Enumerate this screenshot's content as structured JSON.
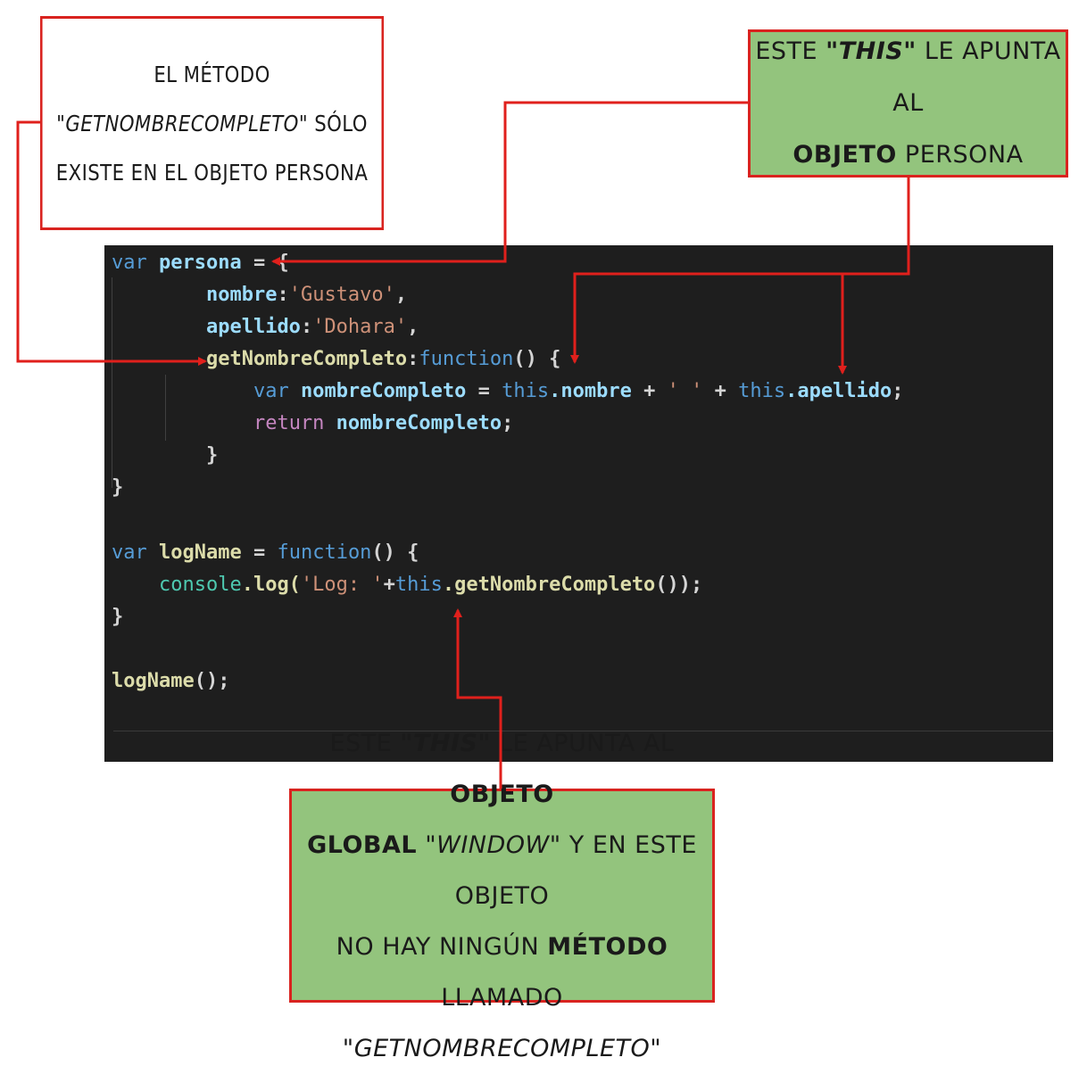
{
  "notes": {
    "method": {
      "line1": "El método",
      "line2_name": "\"getNombreCompleto\"",
      "line2_rest": " sólo",
      "line3": "existe en el objeto persona"
    },
    "this_persona": {
      "w1": "Este",
      "q": "\"this\"",
      "w2": " le apunta al",
      "bold": "objeto",
      "w3": " persona"
    },
    "this_window": {
      "w1": "Este",
      "q": "\"this\"",
      "w2": " le apunta al ",
      "bold1": "objeto",
      "bold2": "global",
      "q2": " \"window\"",
      "w3": " y en este objeto",
      "w4": "no hay ningún ",
      "bold3": "método",
      "w5": " llamado",
      "q3": "\"getNombreCompleto\""
    }
  },
  "code": {
    "l1": {
      "kw": "var",
      "id": "persona",
      "rest": " = {"
    },
    "l2": {
      "key": "nombre",
      "colon": ":",
      "str": "'Gustavo'",
      "end": ","
    },
    "l3": {
      "key": "apellido",
      "colon": ":",
      "str": "'Dohara'",
      "end": ","
    },
    "l4": {
      "key": "getNombreCompleto",
      "colon": ":",
      "kw": "function",
      "end": "() {"
    },
    "l5": {
      "kw": "var",
      "id": "nombreCompleto",
      "eq": " = ",
      "this1": "this",
      "p1": ".nombre",
      "plus1": " + ",
      "str": "' '",
      "plus2": " + ",
      "this2": "this",
      "p2": ".apellido",
      "end": ";"
    },
    "l6": {
      "kw": "return",
      "id": " nombreCompleto",
      "end": ";"
    },
    "l7": {
      "text": "}"
    },
    "l8": {
      "text": "}"
    },
    "l9": {
      "kw": "var",
      "id": "logName",
      "eq": " = ",
      "kw2": "function",
      "end": "() {"
    },
    "l10": {
      "obj": "console",
      "fn": ".log(",
      "str": "'Log: '",
      "plus": "+",
      "this": "this",
      "fn2": ".getNombreCompleto",
      "end": "());"
    },
    "l11": {
      "text": "}"
    },
    "l12": {
      "fn": "logName",
      "end": "();"
    }
  }
}
